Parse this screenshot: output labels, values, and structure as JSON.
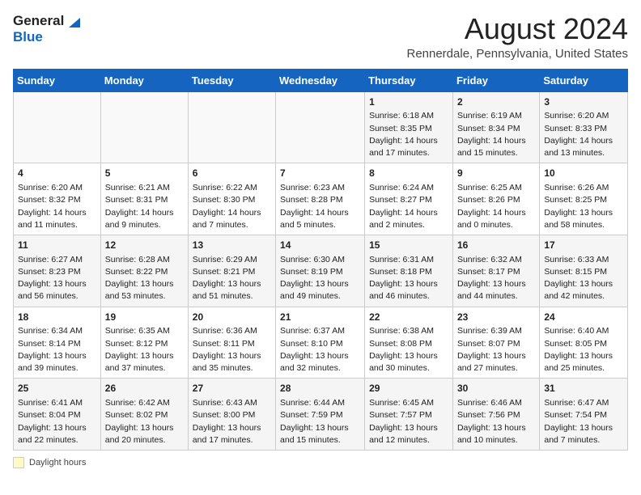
{
  "header": {
    "logo_general": "General",
    "logo_blue": "Blue",
    "title": "August 2024",
    "subtitle": "Rennerdale, Pennsylvania, United States"
  },
  "calendar": {
    "days_of_week": [
      "Sunday",
      "Monday",
      "Tuesday",
      "Wednesday",
      "Thursday",
      "Friday",
      "Saturday"
    ],
    "weeks": [
      [
        {
          "day": "",
          "info": ""
        },
        {
          "day": "",
          "info": ""
        },
        {
          "day": "",
          "info": ""
        },
        {
          "day": "",
          "info": ""
        },
        {
          "day": "1",
          "info": "Sunrise: 6:18 AM\nSunset: 8:35 PM\nDaylight: 14 hours and 17 minutes."
        },
        {
          "day": "2",
          "info": "Sunrise: 6:19 AM\nSunset: 8:34 PM\nDaylight: 14 hours and 15 minutes."
        },
        {
          "day": "3",
          "info": "Sunrise: 6:20 AM\nSunset: 8:33 PM\nDaylight: 14 hours and 13 minutes."
        }
      ],
      [
        {
          "day": "4",
          "info": "Sunrise: 6:20 AM\nSunset: 8:32 PM\nDaylight: 14 hours and 11 minutes."
        },
        {
          "day": "5",
          "info": "Sunrise: 6:21 AM\nSunset: 8:31 PM\nDaylight: 14 hours and 9 minutes."
        },
        {
          "day": "6",
          "info": "Sunrise: 6:22 AM\nSunset: 8:30 PM\nDaylight: 14 hours and 7 minutes."
        },
        {
          "day": "7",
          "info": "Sunrise: 6:23 AM\nSunset: 8:28 PM\nDaylight: 14 hours and 5 minutes."
        },
        {
          "day": "8",
          "info": "Sunrise: 6:24 AM\nSunset: 8:27 PM\nDaylight: 14 hours and 2 minutes."
        },
        {
          "day": "9",
          "info": "Sunrise: 6:25 AM\nSunset: 8:26 PM\nDaylight: 14 hours and 0 minutes."
        },
        {
          "day": "10",
          "info": "Sunrise: 6:26 AM\nSunset: 8:25 PM\nDaylight: 13 hours and 58 minutes."
        }
      ],
      [
        {
          "day": "11",
          "info": "Sunrise: 6:27 AM\nSunset: 8:23 PM\nDaylight: 13 hours and 56 minutes."
        },
        {
          "day": "12",
          "info": "Sunrise: 6:28 AM\nSunset: 8:22 PM\nDaylight: 13 hours and 53 minutes."
        },
        {
          "day": "13",
          "info": "Sunrise: 6:29 AM\nSunset: 8:21 PM\nDaylight: 13 hours and 51 minutes."
        },
        {
          "day": "14",
          "info": "Sunrise: 6:30 AM\nSunset: 8:19 PM\nDaylight: 13 hours and 49 minutes."
        },
        {
          "day": "15",
          "info": "Sunrise: 6:31 AM\nSunset: 8:18 PM\nDaylight: 13 hours and 46 minutes."
        },
        {
          "day": "16",
          "info": "Sunrise: 6:32 AM\nSunset: 8:17 PM\nDaylight: 13 hours and 44 minutes."
        },
        {
          "day": "17",
          "info": "Sunrise: 6:33 AM\nSunset: 8:15 PM\nDaylight: 13 hours and 42 minutes."
        }
      ],
      [
        {
          "day": "18",
          "info": "Sunrise: 6:34 AM\nSunset: 8:14 PM\nDaylight: 13 hours and 39 minutes."
        },
        {
          "day": "19",
          "info": "Sunrise: 6:35 AM\nSunset: 8:12 PM\nDaylight: 13 hours and 37 minutes."
        },
        {
          "day": "20",
          "info": "Sunrise: 6:36 AM\nSunset: 8:11 PM\nDaylight: 13 hours and 35 minutes."
        },
        {
          "day": "21",
          "info": "Sunrise: 6:37 AM\nSunset: 8:10 PM\nDaylight: 13 hours and 32 minutes."
        },
        {
          "day": "22",
          "info": "Sunrise: 6:38 AM\nSunset: 8:08 PM\nDaylight: 13 hours and 30 minutes."
        },
        {
          "day": "23",
          "info": "Sunrise: 6:39 AM\nSunset: 8:07 PM\nDaylight: 13 hours and 27 minutes."
        },
        {
          "day": "24",
          "info": "Sunrise: 6:40 AM\nSunset: 8:05 PM\nDaylight: 13 hours and 25 minutes."
        }
      ],
      [
        {
          "day": "25",
          "info": "Sunrise: 6:41 AM\nSunset: 8:04 PM\nDaylight: 13 hours and 22 minutes."
        },
        {
          "day": "26",
          "info": "Sunrise: 6:42 AM\nSunset: 8:02 PM\nDaylight: 13 hours and 20 minutes."
        },
        {
          "day": "27",
          "info": "Sunrise: 6:43 AM\nSunset: 8:00 PM\nDaylight: 13 hours and 17 minutes."
        },
        {
          "day": "28",
          "info": "Sunrise: 6:44 AM\nSunset: 7:59 PM\nDaylight: 13 hours and 15 minutes."
        },
        {
          "day": "29",
          "info": "Sunrise: 6:45 AM\nSunset: 7:57 PM\nDaylight: 13 hours and 12 minutes."
        },
        {
          "day": "30",
          "info": "Sunrise: 6:46 AM\nSunset: 7:56 PM\nDaylight: 13 hours and 10 minutes."
        },
        {
          "day": "31",
          "info": "Sunrise: 6:47 AM\nSunset: 7:54 PM\nDaylight: 13 hours and 7 minutes."
        }
      ]
    ]
  },
  "footer": {
    "daylight_label": "Daylight hours"
  }
}
